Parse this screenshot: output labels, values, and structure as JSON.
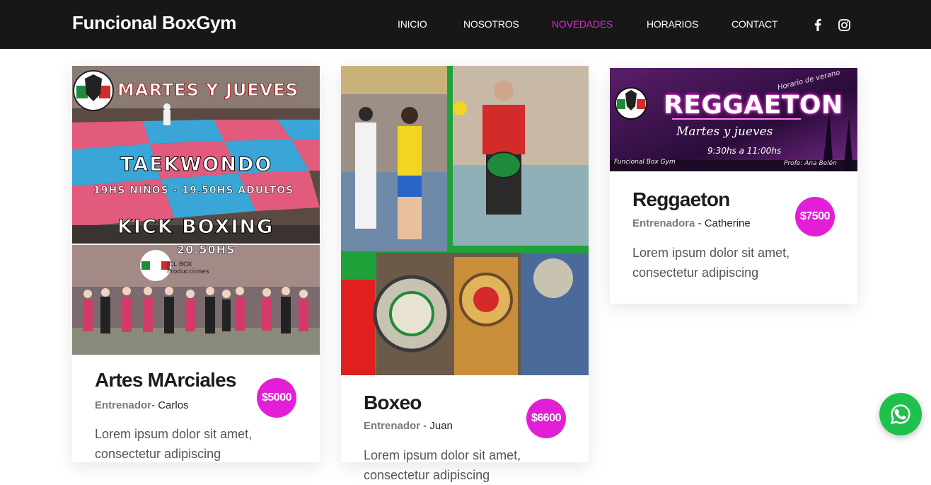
{
  "nav": {
    "brand": "Funcional BoxGym",
    "links": [
      {
        "label": "INICIO",
        "active": false
      },
      {
        "label": "NOSOTROS",
        "active": false
      },
      {
        "label": "NOVEDADES",
        "active": true
      },
      {
        "label": "HORARIOS",
        "active": false
      },
      {
        "label": "CONTACT",
        "active": false
      }
    ],
    "social": [
      "facebook-icon",
      "instagram-icon"
    ]
  },
  "colors": {
    "navbar_bg": "#171717",
    "accent": "#e21fd7",
    "whatsapp": "#1fc14c"
  },
  "cards": [
    {
      "title": "Artes MArciales",
      "trainer_label": "Entrenador",
      "trainer_sep": "- ",
      "trainer_name": "Carlos",
      "price": "$5000",
      "description": "Lorem ipsum dolor sit amet, consectetur adipiscing",
      "poster": {
        "line1": "MARTES Y JUEVES",
        "line2": "TAEKWONDO",
        "line3": "19HS NIÑOS - 19.50HS ADULTOS",
        "line4": "KICK BOXING",
        "line5": "20.50HS",
        "sign": "JCL BOX Producciones"
      }
    },
    {
      "title": "Boxeo",
      "trainer_label": "Entrenador",
      "trainer_sep": " - ",
      "trainer_name": "Juan",
      "price": "$6600",
      "description": "Lorem ipsum dolor sit amet, consectetur adipiscing"
    },
    {
      "title": "Reggaeton",
      "trainer_label": "Entrenadora",
      "trainer_sep": " - ",
      "trainer_name": "Catherine",
      "price": "$7500",
      "description": "Lorem ipsum dolor sit amet, consectetur adipiscing",
      "poster": {
        "headline": "REGGAETON",
        "corner": "Horario de verano",
        "days": "Martes y jueves",
        "time": "9:30hs a 11:00hs",
        "handle": "Funcional Box Gym",
        "teacher": "Profe: Ana Belén"
      }
    }
  ]
}
